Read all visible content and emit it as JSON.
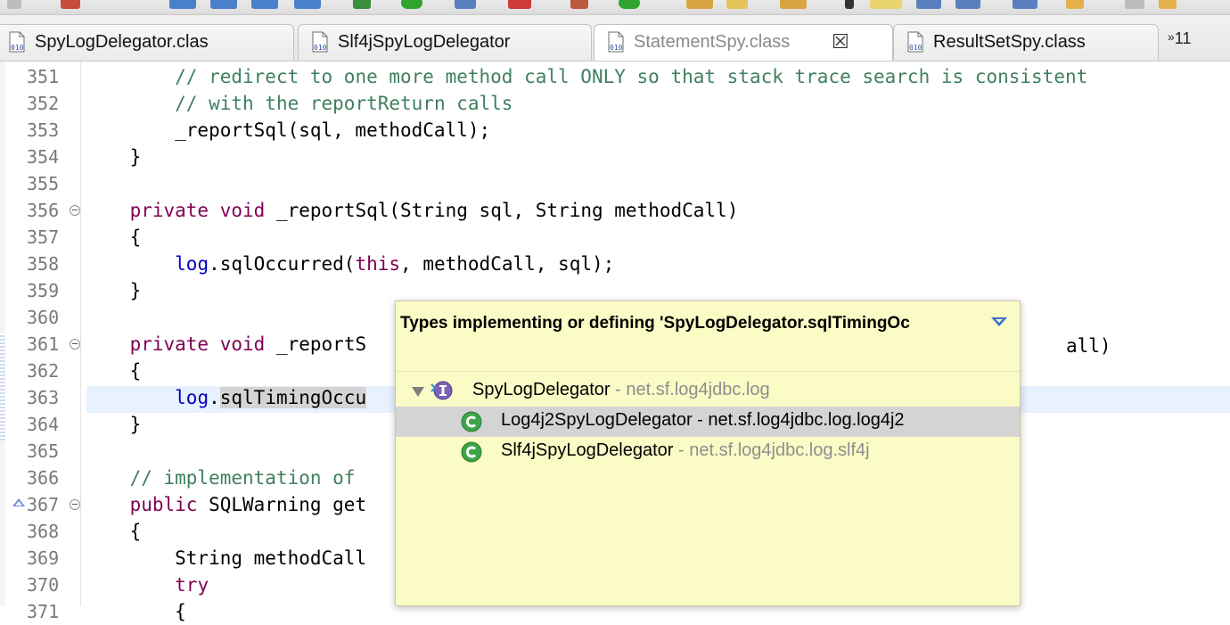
{
  "tabs": [
    {
      "label": "SpyLogDelegator.clas",
      "active": false,
      "closable": false
    },
    {
      "label": "Slf4jSpyLogDelegator",
      "active": false,
      "closable": false
    },
    {
      "label": "StatementSpy.class",
      "active": true,
      "closable": true
    },
    {
      "label": "ResultSetSpy.class",
      "active": false,
      "closable": false
    }
  ],
  "tab_overflow": {
    "chevron": "»",
    "count": "11"
  },
  "editor": {
    "lines": [
      {
        "n": "351",
        "segs": [
          {
            "t": "        "
          },
          {
            "t": "// redirect to one more method call ONLY so that stack trace search is consistent",
            "c": "cm"
          }
        ]
      },
      {
        "n": "352",
        "segs": [
          {
            "t": "        "
          },
          {
            "t": "// with the reportReturn calls",
            "c": "cm"
          }
        ]
      },
      {
        "n": "353",
        "segs": [
          {
            "t": "        _reportSql(sql, methodCall);"
          }
        ]
      },
      {
        "n": "354",
        "segs": [
          {
            "t": "    }"
          }
        ]
      },
      {
        "n": "355",
        "segs": []
      },
      {
        "n": "356",
        "segs": [
          {
            "t": "    "
          },
          {
            "t": "private",
            "c": "kw"
          },
          {
            "t": " "
          },
          {
            "t": "void",
            "c": "kw"
          },
          {
            "t": " _reportSql(String sql, String methodCall)"
          }
        ]
      },
      {
        "n": "357",
        "segs": [
          {
            "t": "    {"
          }
        ]
      },
      {
        "n": "358",
        "segs": [
          {
            "t": "        "
          },
          {
            "t": "log",
            "c": "fld"
          },
          {
            "t": ".sqlOccurred("
          },
          {
            "t": "this",
            "c": "kw"
          },
          {
            "t": ", methodCall, sql);"
          }
        ]
      },
      {
        "n": "359",
        "segs": [
          {
            "t": "    }"
          }
        ]
      },
      {
        "n": "360",
        "segs": []
      },
      {
        "n": "361",
        "segs": [
          {
            "t": "    "
          },
          {
            "t": "private",
            "c": "kw"
          },
          {
            "t": " "
          },
          {
            "t": "void",
            "c": "kw"
          },
          {
            "t": " _reportS"
          }
        ]
      },
      {
        "n": "362",
        "segs": [
          {
            "t": "    {"
          }
        ]
      },
      {
        "n": "363",
        "segs": [
          {
            "t": "        "
          },
          {
            "t": "log",
            "c": "fld"
          },
          {
            "t": "."
          },
          {
            "t": "sqlTimingOccu",
            "c": "occ"
          }
        ]
      },
      {
        "n": "364",
        "segs": [
          {
            "t": "    }"
          }
        ]
      },
      {
        "n": "365",
        "segs": []
      },
      {
        "n": "366",
        "segs": [
          {
            "t": "    "
          },
          {
            "t": "// implementation of",
            "c": "cm"
          }
        ]
      },
      {
        "n": "367",
        "segs": [
          {
            "t": "    "
          },
          {
            "t": "public",
            "c": "kw"
          },
          {
            "t": " SQLWarning get"
          }
        ]
      },
      {
        "n": "368",
        "segs": [
          {
            "t": "    {"
          }
        ]
      },
      {
        "n": "369",
        "segs": [
          {
            "t": "        String methodCall"
          }
        ]
      },
      {
        "n": "370",
        "segs": [
          {
            "t": "        "
          },
          {
            "t": "try",
            "c": "kw"
          }
        ]
      },
      {
        "n": "371",
        "segs": [
          {
            "t": "        {"
          }
        ]
      }
    ],
    "line_361_tail": "all)"
  },
  "popup": {
    "title": "Types implementing or defining 'SpyLogDelegator.sqlTimingOc",
    "items": [
      {
        "name": "SpyLogDelegator",
        "sep": " - ",
        "pkg": "net.sf.log4jdbc.log",
        "kind": "interface",
        "selected": false
      },
      {
        "name": "Log4j2SpyLogDelegator",
        "sep": " - ",
        "pkg": "net.sf.log4jdbc.log.log4j2",
        "kind": "class",
        "selected": true
      },
      {
        "name": "Slf4jSpyLogDelegator",
        "sep": " - ",
        "pkg": "net.sf.log4jdbc.log.slf4j",
        "kind": "class",
        "selected": false
      }
    ]
  },
  "colors": {
    "comment": "#3f7f5f",
    "keyword": "#7f0055",
    "field": "#0000c0",
    "popup_bg": "#fbfbc6"
  }
}
